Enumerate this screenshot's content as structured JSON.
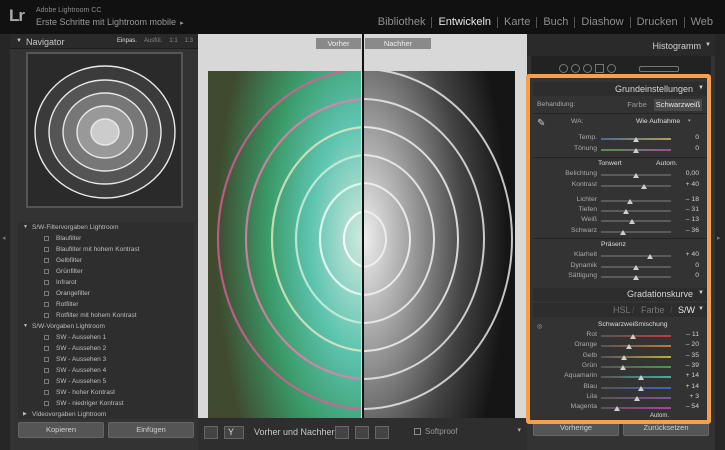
{
  "app": {
    "logo": "Lr",
    "name": "Adobe Lightroom CC",
    "catalog_title": "Erste Schritte mit Lightroom mobile",
    "catalog_arrow": "▸"
  },
  "modules": [
    {
      "label": "Bibliothek"
    },
    {
      "label": "Entwickeln",
      "active": true
    },
    {
      "label": "Karte"
    },
    {
      "label": "Buch"
    },
    {
      "label": "Diashow"
    },
    {
      "label": "Drucken"
    },
    {
      "label": "Web"
    }
  ],
  "navigator": {
    "title": "Navigator",
    "zoom_options": [
      "Einpas.",
      "Ausfül.",
      "1:1",
      "1:3"
    ]
  },
  "presets": {
    "groups": [
      {
        "name": "S/W-Filtervorgaben Lightroom",
        "items": [
          "Blaufilter",
          "Blaufilter mit hohem Kontrast",
          "Gelbfilter",
          "Grünfilter",
          "Infrarot",
          "Orangefilter",
          "Rotfilter",
          "Rotfilter mit hohem Kontrast"
        ]
      },
      {
        "name": "S/W-Vorgaben Lightroom",
        "items": [
          "SW - Aussehen 1",
          "SW - Aussehen 2",
          "SW - Aussehen 3",
          "SW - Aussehen 4",
          "SW - Aussehen 5",
          "SW - hoher Kontrast",
          "SW - niedriger Kontrast"
        ]
      },
      {
        "name": "Videovorgaben Lightroom",
        "items": []
      }
    ]
  },
  "left_buttons": {
    "copy": "Kopieren",
    "paste": "Einfügen"
  },
  "view": {
    "before_label": "Vorher",
    "after_label": "Nachher"
  },
  "toolbar": {
    "label": "Vorher und Nachher:",
    "softproof": "Softproof",
    "menu": "▾"
  },
  "histogram": {
    "title": "Histogramm"
  },
  "basic": {
    "title": "Grundeinstellungen",
    "treatment_label": "Behandlung:",
    "treatment_color": "Farbe",
    "treatment_bw": "Schwarzweiß",
    "wb_label": "WA:",
    "wb_value": "Wie Aufnahme",
    "temp_label": "Temp.",
    "temp_value": "0",
    "temp_pos": 0.5,
    "tint_label": "Tönung",
    "tint_value": "0",
    "tint_pos": 0.5,
    "tone_label": "Tonwert",
    "tone_auto": "Autom.",
    "tone_sliders": [
      {
        "label": "Belichtung",
        "value": "0,00",
        "pos": 0.5
      },
      {
        "label": "Kontrast",
        "value": "+ 40",
        "pos": 0.62
      },
      {
        "label": "Lichter",
        "value": "– 18",
        "pos": 0.41
      },
      {
        "label": "Tiefen",
        "value": "– 31",
        "pos": 0.35
      },
      {
        "label": "Weiß",
        "value": "– 13",
        "pos": 0.44
      },
      {
        "label": "Schwarz",
        "value": "– 36",
        "pos": 0.32
      }
    ],
    "presence_label": "Präsenz",
    "presence_sliders": [
      {
        "label": "Klarheit",
        "value": "+ 40",
        "pos": 0.7
      },
      {
        "label": "Dynamik",
        "value": "0",
        "pos": 0.5
      },
      {
        "label": "Sättigung",
        "value": "0",
        "pos": 0.5
      }
    ]
  },
  "tone_curve": {
    "title": "Gradationskurve"
  },
  "hsl": {
    "tab_hsl": "HSL",
    "tab_color": "Farbe",
    "tab_bw": "S/W",
    "bw_mix_title": "Schwarzweißmischung",
    "sliders": [
      {
        "label": "Rot",
        "value": "– 11",
        "pos": 0.45,
        "color": "#c04040"
      },
      {
        "label": "Orange",
        "value": "– 20",
        "pos": 0.4,
        "color": "#c07a30"
      },
      {
        "label": "Gelb",
        "value": "– 35",
        "pos": 0.33,
        "color": "#c0b030"
      },
      {
        "label": "Grün",
        "value": "– 39",
        "pos": 0.31,
        "color": "#40a040"
      },
      {
        "label": "Aquamarin",
        "value": "+ 14",
        "pos": 0.57,
        "color": "#40b0a0"
      },
      {
        "label": "Blau",
        "value": "+ 14",
        "pos": 0.57,
        "color": "#4060c0"
      },
      {
        "label": "Lila",
        "value": "+ 3",
        "pos": 0.52,
        "color": "#8050b0"
      },
      {
        "label": "Magenta",
        "value": "– 54",
        "pos": 0.23,
        "color": "#b040a0"
      }
    ],
    "auto_label": "Autom."
  },
  "right_buttons": {
    "previous": "Vorherige",
    "reset": "Zurücksetzen"
  },
  "colors": {
    "highlight": "#f5a04b"
  }
}
